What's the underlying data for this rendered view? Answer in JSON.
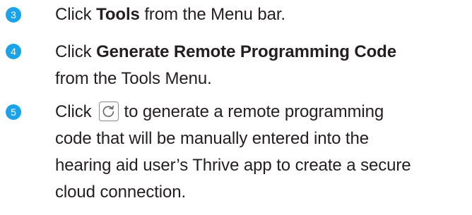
{
  "accent_color": "#1aa3e8",
  "steps": [
    {
      "number": "3",
      "lines": [
        {
          "pre": "Click ",
          "bold": "Tools",
          "post": " from the Menu bar."
        }
      ]
    },
    {
      "number": "4",
      "lines": [
        {
          "pre": "Click ",
          "bold": "Generate Remote Programming Code",
          "post": ""
        },
        {
          "text": "from the Tools Menu."
        }
      ]
    },
    {
      "number": "5",
      "lines": [
        {
          "pre": "Click",
          "icon": "refresh-icon",
          "post": "to generate a remote programming"
        },
        {
          "text": "code that will be manually entered into the"
        },
        {
          "text": "hearing aid user’s Thrive app to create a secure"
        },
        {
          "text": "cloud connection."
        }
      ]
    }
  ]
}
